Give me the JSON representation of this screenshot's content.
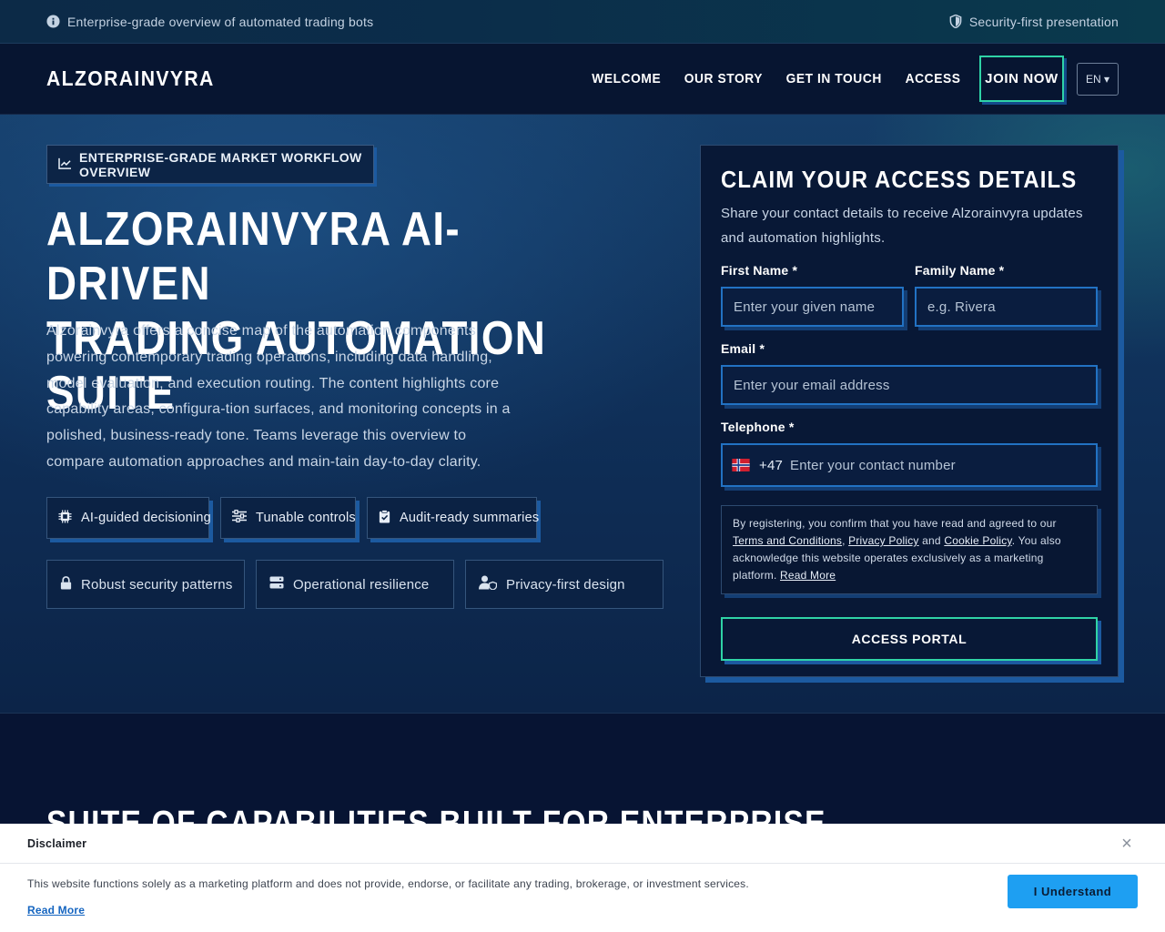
{
  "topbar": {
    "left_text": "Enterprise-grade overview of automated trading bots",
    "right_text": "Security-first presentation"
  },
  "nav": {
    "logo": "ALZORAINVYRA",
    "links": [
      "WELCOME",
      "OUR STORY",
      "GET IN TOUCH",
      "ACCESS"
    ],
    "join_label": "JOIN NOW",
    "lang_label": "EN ▾"
  },
  "hero": {
    "badge": "ENTERPRISE-GRADE MARKET WORKFLOW OVERVIEW",
    "title_line1": "ALZORAINVYRA AI-DRIVEN",
    "title_line2": "TRADING AUTOMATION SUITE",
    "description": "Alzorainvyra offers a concise map of the automation components powering contemporary trading operations, including data handling, model evaluation, and execution routing. The content highlights core capability areas, configura-tion surfaces, and monitoring concepts in a polished, business-ready tone. Teams leverage this overview to compare automation approaches and main-tain day-to-day clarity.",
    "chips_row1": [
      "AI-guided decisioning",
      "Tunable controls",
      "Audit-ready summaries"
    ],
    "chips_row2": [
      "Robust security patterns",
      "Operational resilience",
      "Privacy-first design"
    ]
  },
  "form": {
    "title": "CLAIM YOUR ACCESS DETAILS",
    "subtitle": "Share your contact details to receive Alzorainvyra updates and automation highlights.",
    "first_name_label": "First Name *",
    "first_name_placeholder": "Enter your given name",
    "family_name_label": "Family Name *",
    "family_name_placeholder": "e.g. Rivera",
    "email_label": "Email *",
    "email_placeholder": "Enter your email address",
    "phone_label": "Telephone *",
    "phone_code": "+47",
    "phone_placeholder": "Enter your contact number",
    "legal_1": "By registering, you confirm that you have read and agreed to our ",
    "legal_terms": "Terms and Conditions",
    "legal_2": ", ",
    "legal_privacy": "Privacy Policy",
    "legal_3": " and ",
    "legal_cookie": "Cookie Policy",
    "legal_4": ". You also acknowledge this website operates exclusively as a marketing platform. ",
    "legal_read_more": "Read More",
    "submit_label": "ACCESS PORTAL"
  },
  "section2": {
    "title": "SUITE OF CAPABILITIES BUILT FOR ENTERPRISE"
  },
  "disclaimer": {
    "title": "Disclaimer",
    "text": "This website functions solely as a marketing platform and does not provide, endorse, or facilitate any trading, brokerage, or investment services.",
    "read_more": "Read More",
    "button": "I Understand",
    "close": "×"
  },
  "colors": {
    "accent_green": "#2fd3a6",
    "accent_blue": "#1e9ff2",
    "field_border": "#2272c3"
  }
}
